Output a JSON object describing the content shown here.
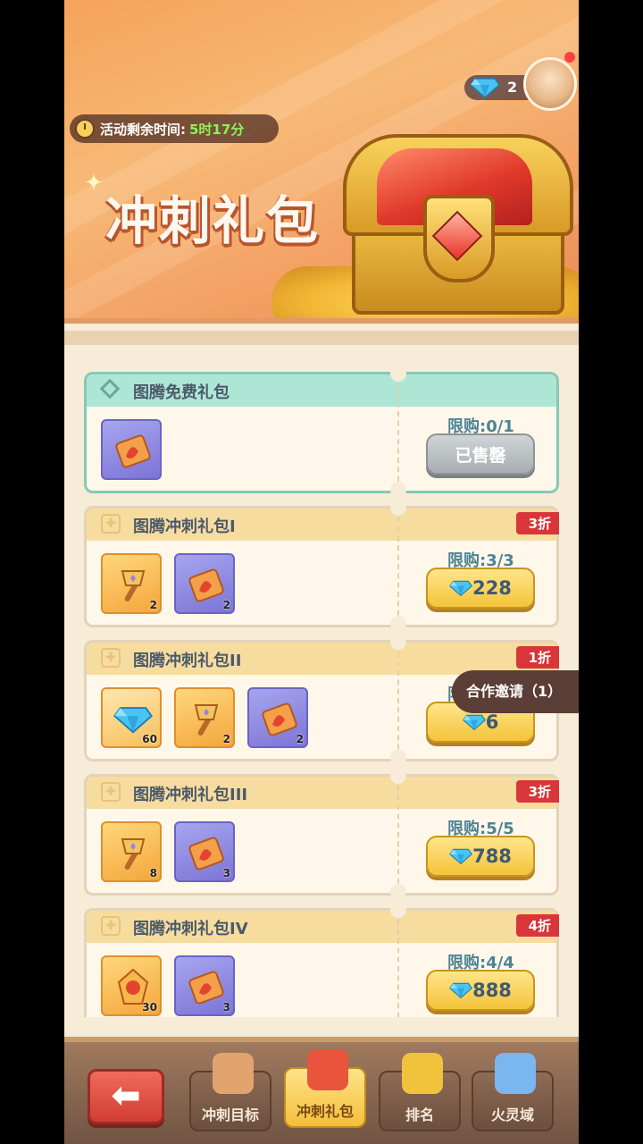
{
  "header": {
    "timer_label": "活动剩余时间:",
    "timer_value": "5时17分",
    "gem_count": "2",
    "title": "冲刺礼包"
  },
  "packs": [
    {
      "title": "图腾免费礼包",
      "limit": "限购:0/1",
      "button": "已售罄",
      "sold_out": true,
      "items": [
        {
          "icon": "totem-scroll-icon",
          "type": "purple",
          "qty": ""
        }
      ]
    },
    {
      "title": "图腾冲刺礼包I",
      "discount": "3折",
      "limit": "限购:3/3",
      "price": "228",
      "items": [
        {
          "icon": "axe-icon",
          "type": "gold",
          "qty": "2"
        },
        {
          "icon": "totem-scroll-icon",
          "type": "purple",
          "qty": "2"
        }
      ]
    },
    {
      "title": "图腾冲刺礼包II",
      "discount": "1折",
      "limit": "限",
      "price": "6",
      "items": [
        {
          "icon": "diamond-icon",
          "type": "blue",
          "qty": "60"
        },
        {
          "icon": "axe-icon",
          "type": "gold",
          "qty": "2"
        },
        {
          "icon": "totem-scroll-icon",
          "type": "purple",
          "qty": "2"
        }
      ]
    },
    {
      "title": "图腾冲刺礼包III",
      "discount": "3折",
      "limit": "限购:5/5",
      "price": "788",
      "items": [
        {
          "icon": "axe-icon",
          "type": "gold",
          "qty": "8"
        },
        {
          "icon": "totem-scroll-icon",
          "type": "purple",
          "qty": "3"
        }
      ]
    },
    {
      "title": "图腾冲刺礼包IV",
      "discount": "4折",
      "limit": "限购:4/4",
      "price": "888",
      "items": [
        {
          "icon": "fire-crystal-icon",
          "type": "gold",
          "qty": "30"
        },
        {
          "icon": "totem-scroll-icon",
          "type": "purple",
          "qty": "3"
        }
      ]
    }
  ],
  "invite_popup": "合作邀请（1）",
  "nav": {
    "back": "back-arrow-icon",
    "tabs": [
      {
        "label": "冲刺目标",
        "icon": "scroll-icon",
        "active": false
      },
      {
        "label": "冲刺礼包",
        "icon": "gift-chest-icon",
        "active": true
      },
      {
        "label": "排名",
        "icon": "trophy-icon",
        "active": false
      },
      {
        "label": "火灵域",
        "icon": "crystal-icon",
        "active": false
      }
    ]
  },
  "colors": {
    "accent": "#f4c43a",
    "discount": "#d8363a",
    "free": "#aee6d6",
    "limit_text": "#4e8396"
  }
}
